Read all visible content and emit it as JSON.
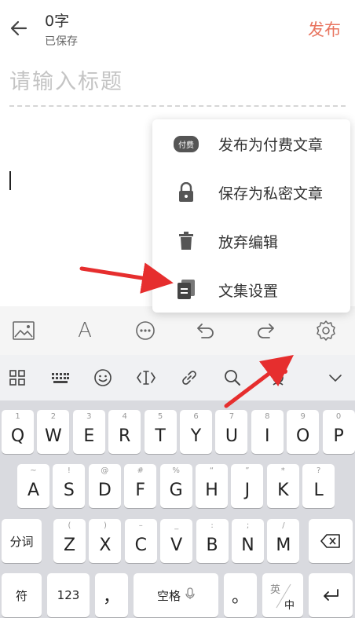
{
  "header": {
    "word_count": "0字",
    "save_status": "已保存",
    "publish_label": "发布"
  },
  "editor": {
    "title_placeholder": "请输入标题"
  },
  "menu": {
    "items": [
      {
        "label": "发布为付费文章",
        "icon": "paid-badge-icon",
        "badge": "付费"
      },
      {
        "label": "保存为私密文章",
        "icon": "lock-icon"
      },
      {
        "label": "放弃编辑",
        "icon": "trash-icon"
      },
      {
        "label": "文集设置",
        "icon": "collection-icon"
      }
    ]
  },
  "toolbar": {
    "icons": [
      "image-icon",
      "font-icon",
      "more-icon",
      "undo-icon",
      "redo-icon",
      "settings-icon"
    ],
    "font_glyph": "A"
  },
  "keyboard": {
    "top_icons": [
      "grid-icon",
      "keyboard-icon",
      "emoji-icon",
      "cursor-move-icon",
      "link-icon",
      "search-icon",
      "voice-icon",
      "collapse-icon"
    ],
    "row1": [
      {
        "main": "Q",
        "sub": "1"
      },
      {
        "main": "W",
        "sub": "2"
      },
      {
        "main": "E",
        "sub": "3"
      },
      {
        "main": "R",
        "sub": "4"
      },
      {
        "main": "T",
        "sub": "5"
      },
      {
        "main": "Y",
        "sub": "6"
      },
      {
        "main": "U",
        "sub": "7"
      },
      {
        "main": "I",
        "sub": "8"
      },
      {
        "main": "O",
        "sub": "9"
      },
      {
        "main": "P",
        "sub": "0"
      }
    ],
    "row2": [
      {
        "main": "A",
        "sub": "~"
      },
      {
        "main": "S",
        "sub": "!"
      },
      {
        "main": "D",
        "sub": "@"
      },
      {
        "main": "F",
        "sub": "#"
      },
      {
        "main": "G",
        "sub": "%"
      },
      {
        "main": "H",
        "sub": "“"
      },
      {
        "main": "J",
        "sub": "”"
      },
      {
        "main": "K",
        "sub": "*"
      },
      {
        "main": "L",
        "sub": "?"
      }
    ],
    "row3": [
      {
        "main": "Z",
        "sub": "("
      },
      {
        "main": "X",
        "sub": ")"
      },
      {
        "main": "C",
        "sub": "–"
      },
      {
        "main": "V",
        "sub": "_"
      },
      {
        "main": "B",
        "sub": ":"
      },
      {
        "main": "N",
        "sub": ";"
      },
      {
        "main": "M",
        "sub": "/"
      }
    ],
    "fenci": "分词",
    "fu": "符",
    "num": "123",
    "comma": "，",
    "space": "空格",
    "period": "。",
    "lang_en": "英",
    "lang_zh": "中"
  },
  "colors": {
    "accent": "#e8745f",
    "annotation_arrow": "#e62e2e"
  }
}
